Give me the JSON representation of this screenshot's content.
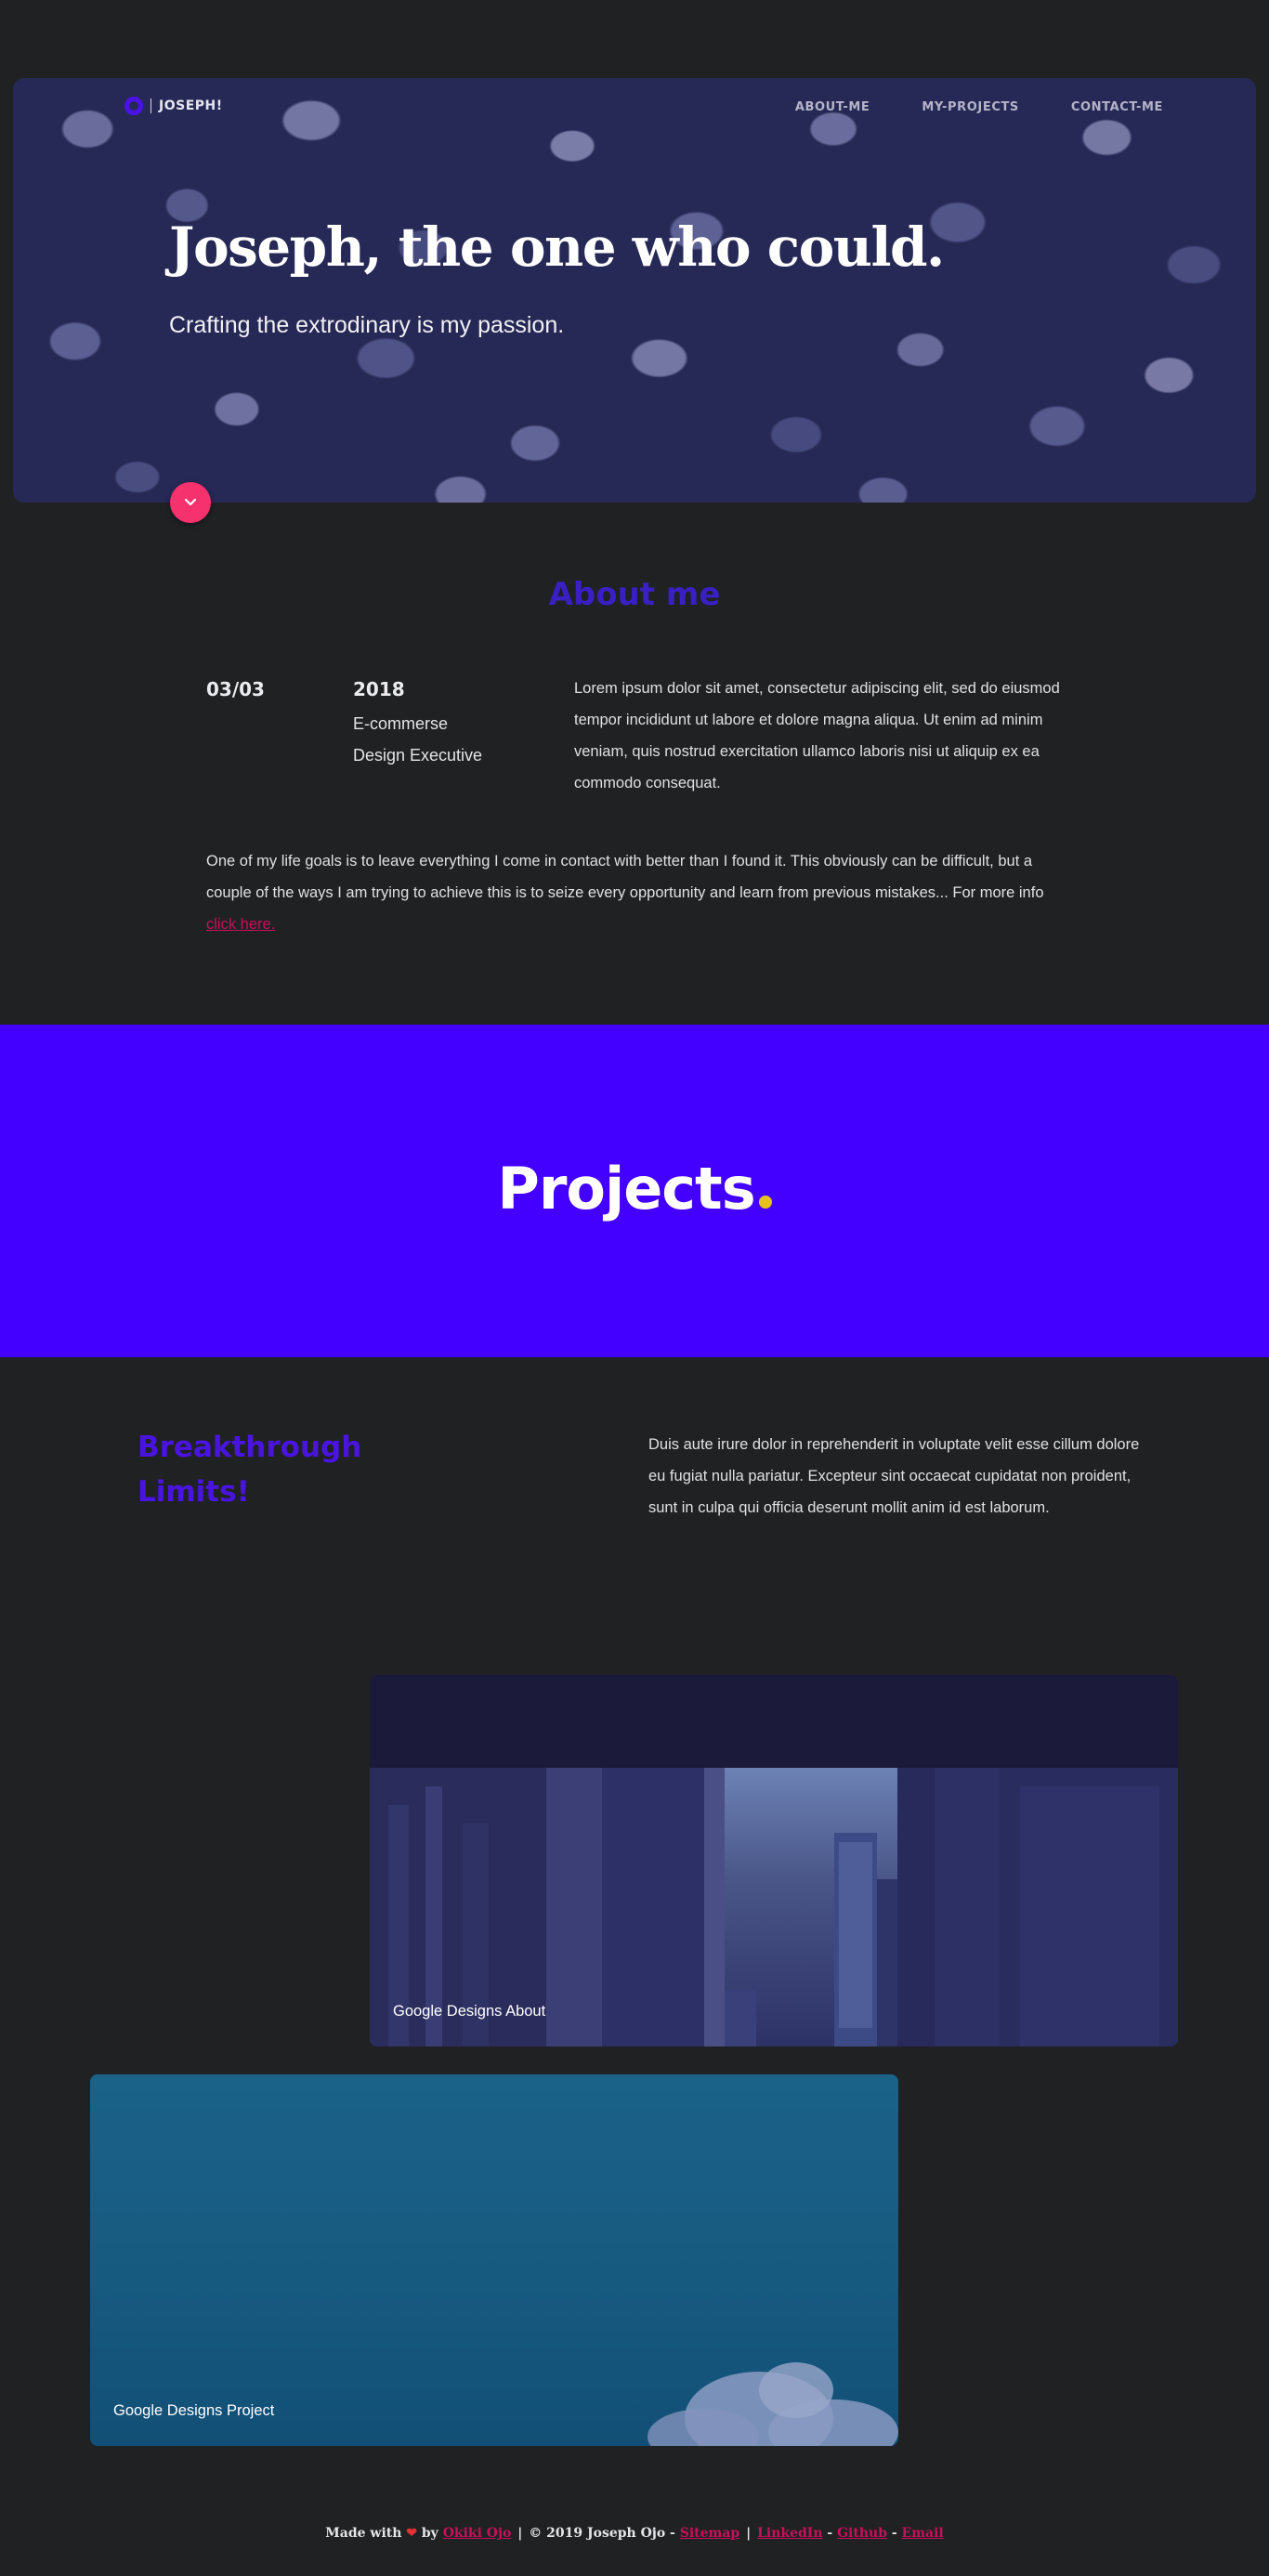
{
  "nav": {
    "logo_text": "JOSEPH!",
    "links": [
      "ABOUT-ME",
      "MY-PROJECTS",
      "CONTACT-ME"
    ]
  },
  "hero": {
    "title": "Joseph, the one who could.",
    "subtitle": "Crafting the extrodinary is my passion.",
    "scroll_icon": "chevron-down-icon"
  },
  "about": {
    "title": "About me",
    "date": "03/03",
    "year": "2018",
    "role_line1": "E-commerse",
    "role_line2": "Design Executive",
    "description": "Lorem ipsum dolor sit amet, consectetur adipiscing elit, sed do eiusmod tempor incididunt ut labore et dolore magna aliqua. Ut enim ad minim veniam, quis nostrud exercitation ullamco laboris nisi ut aliquip ex ea commodo consequat.",
    "goal": "One of my life goals is to leave everything I come in contact with better than I found it. This obviously can be difficult, but a couple of the ways I am trying to achieve this is to seize every opportunity and learn from previous mistakes... For more info ",
    "link_text": "click here."
  },
  "projects": {
    "title": "Projects",
    "dot_color": "#e8c21c",
    "banner_color": "#4400ff"
  },
  "breakthrough": {
    "title_line1": "Breakthrough",
    "title_line2": "Limits!",
    "description": "Duis aute irure dolor in reprehenderit in voluptate velit esse cillum dolore eu fugiat nulla pariatur. Excepteur sint occaecat cupidatat non proident, sunt in culpa qui officia deserunt mollit anim id est laborum."
  },
  "cards": [
    {
      "label": "Google Designs About"
    },
    {
      "label": "Google Designs Project"
    }
  ],
  "footer": {
    "made_with": "Made with",
    "heart": "❤",
    "by": "by",
    "author_link": "Okiki Ojo",
    "copyright": "2019 Joseph Ojo -",
    "copyright_symbol": "©",
    "links": [
      "Sitemap",
      "LinkedIn",
      "Github",
      "Email"
    ]
  },
  "colors": {
    "accent_purple": "#3a1fc4",
    "link_pink": "#c8105a",
    "scroll_button": "#f5326e",
    "page_bg": "#202123"
  }
}
